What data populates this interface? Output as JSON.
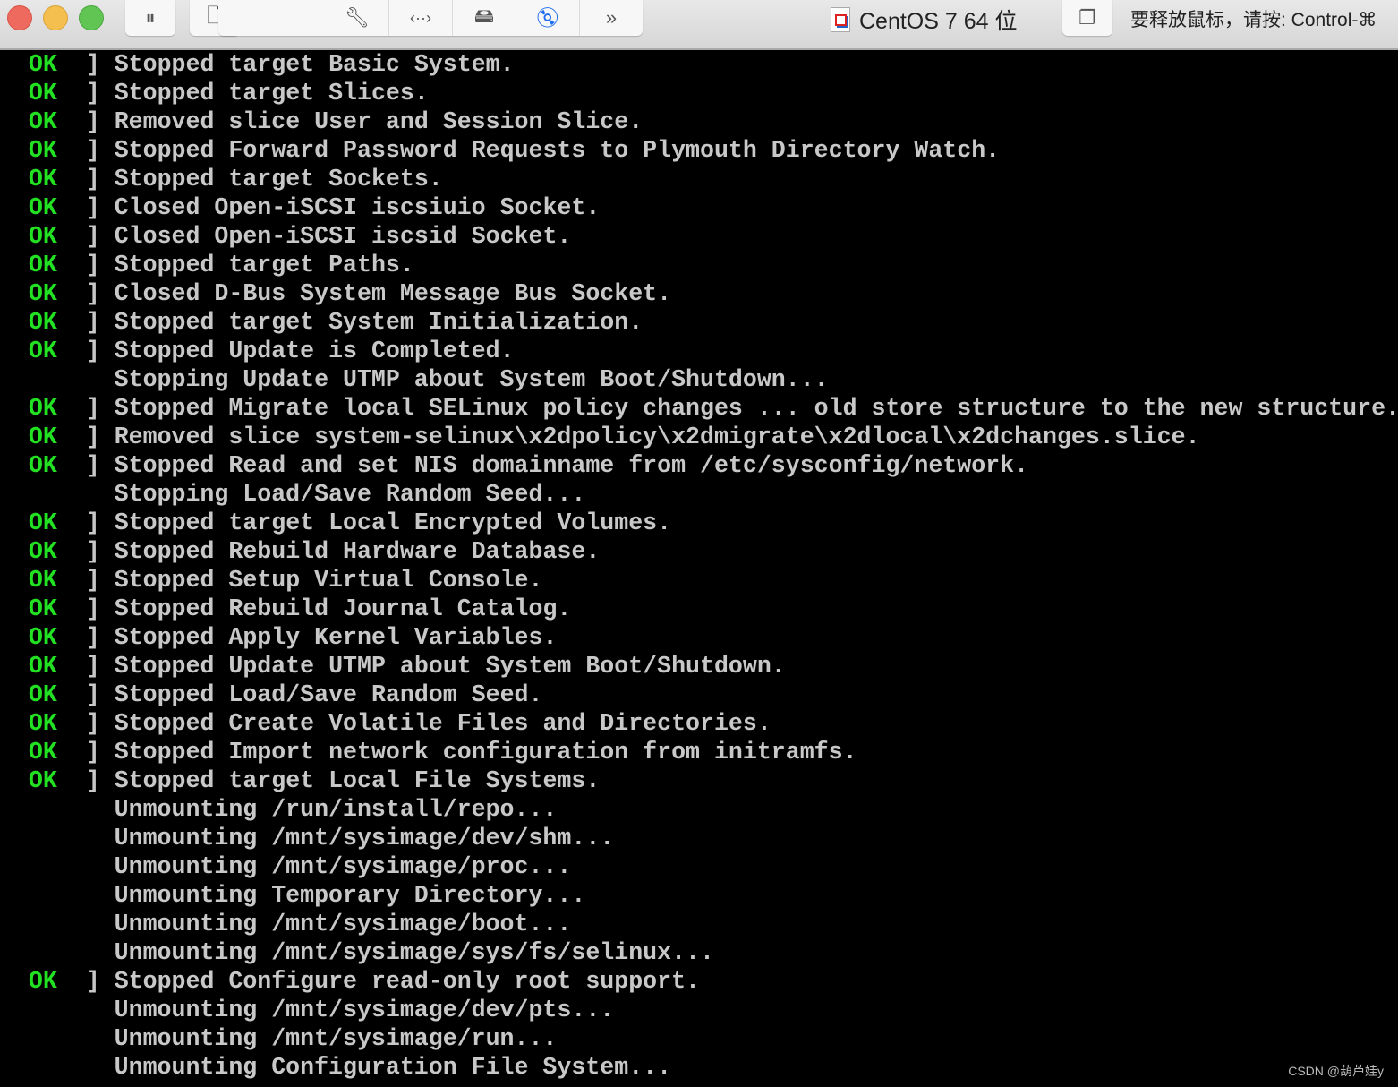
{
  "toolbar": {
    "buttons": [
      {
        "icon": "pause-icon"
      },
      {
        "icon": "snapshot-icon"
      }
    ],
    "group": [
      {
        "icon": "wrench-icon"
      },
      {
        "icon": "network-icon"
      },
      {
        "icon": "disk-icon"
      },
      {
        "icon": "cd-dvd-icon",
        "active": true,
        "color": "#1e6cf0"
      },
      {
        "icon": "chevron-double-right-icon"
      }
    ],
    "vm_title": "CentOS 7 64 位",
    "release_hint": "要释放鼠标，请按: Control-⌘"
  },
  "colors": {
    "ok": "#22e022",
    "text": "#c8c8c8",
    "background": "#000000"
  },
  "console": {
    "ok_label": "OK",
    "lines": [
      {
        "ok": true,
        "text": "Stopped target Basic System."
      },
      {
        "ok": true,
        "text": "Stopped target Slices."
      },
      {
        "ok": true,
        "text": "Removed slice User and Session Slice."
      },
      {
        "ok": true,
        "text": "Stopped Forward Password Requests to Plymouth Directory Watch."
      },
      {
        "ok": true,
        "text": "Stopped target Sockets."
      },
      {
        "ok": true,
        "text": "Closed Open-iSCSI iscsiuio Socket."
      },
      {
        "ok": true,
        "text": "Closed Open-iSCSI iscsid Socket."
      },
      {
        "ok": true,
        "text": "Stopped target Paths."
      },
      {
        "ok": true,
        "text": "Closed D-Bus System Message Bus Socket."
      },
      {
        "ok": true,
        "text": "Stopped target System Initialization."
      },
      {
        "ok": true,
        "text": "Stopped Update is Completed."
      },
      {
        "ok": false,
        "text": "Stopping Update UTMP about System Boot/Shutdown..."
      },
      {
        "ok": true,
        "text": "Stopped Migrate local SELinux policy changes ... old store structure to the new structure."
      },
      {
        "ok": true,
        "text": "Removed slice system-selinux\\x2dpolicy\\x2dmigrate\\x2dlocal\\x2dchanges.slice."
      },
      {
        "ok": true,
        "text": "Stopped Read and set NIS domainname from /etc/sysconfig/network."
      },
      {
        "ok": false,
        "text": "Stopping Load/Save Random Seed..."
      },
      {
        "ok": true,
        "text": "Stopped target Local Encrypted Volumes."
      },
      {
        "ok": true,
        "text": "Stopped Rebuild Hardware Database."
      },
      {
        "ok": true,
        "text": "Stopped Setup Virtual Console."
      },
      {
        "ok": true,
        "text": "Stopped Rebuild Journal Catalog."
      },
      {
        "ok": true,
        "text": "Stopped Apply Kernel Variables."
      },
      {
        "ok": true,
        "text": "Stopped Update UTMP about System Boot/Shutdown."
      },
      {
        "ok": true,
        "text": "Stopped Load/Save Random Seed."
      },
      {
        "ok": true,
        "text": "Stopped Create Volatile Files and Directories."
      },
      {
        "ok": true,
        "text": "Stopped Import network configuration from initramfs."
      },
      {
        "ok": true,
        "text": "Stopped target Local File Systems."
      },
      {
        "ok": false,
        "text": "Unmounting /run/install/repo..."
      },
      {
        "ok": false,
        "text": "Unmounting /mnt/sysimage/dev/shm..."
      },
      {
        "ok": false,
        "text": "Unmounting /mnt/sysimage/proc..."
      },
      {
        "ok": false,
        "text": "Unmounting Temporary Directory..."
      },
      {
        "ok": false,
        "text": "Unmounting /mnt/sysimage/boot..."
      },
      {
        "ok": false,
        "text": "Unmounting /mnt/sysimage/sys/fs/selinux..."
      },
      {
        "ok": true,
        "text": "Stopped Configure read-only root support."
      },
      {
        "ok": false,
        "text": "Unmounting /mnt/sysimage/dev/pts..."
      },
      {
        "ok": false,
        "text": "Unmounting /mnt/sysimage/run..."
      },
      {
        "ok": false,
        "text": "Unmounting Configuration File System..."
      }
    ]
  },
  "watermark": "CSDN @葫芦娃y"
}
